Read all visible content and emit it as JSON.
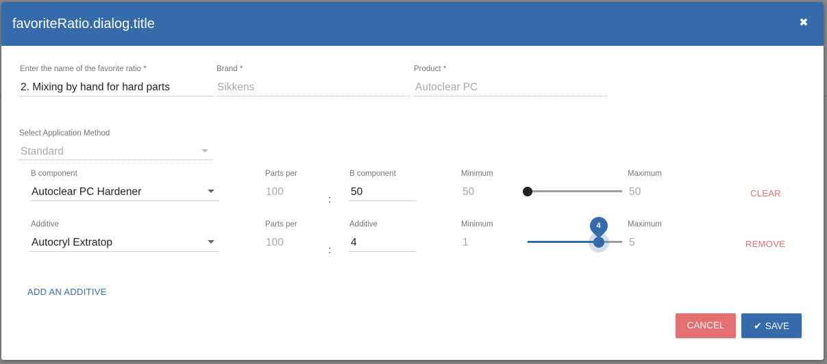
{
  "dialog": {
    "title": "favoriteRatio.dialog.title",
    "close_icon": "close-icon"
  },
  "form": {
    "name": {
      "label": "Enter the name of the favorite ratio *",
      "value": "2. Mixing by hand for hard parts"
    },
    "brand": {
      "label": "Brand *",
      "value": "Sikkens"
    },
    "product": {
      "label": "Product *",
      "value": "Autoclear PC"
    },
    "application_method": {
      "label": "Select Application Method",
      "value": "Standard"
    }
  },
  "rows": [
    {
      "component_label": "B component",
      "component_value": "Autoclear PC Hardener",
      "parts_label": "Parts per",
      "parts_value": "100",
      "separator": ":",
      "amount_label": "B component",
      "amount_value": "50",
      "min_label": "Minimum",
      "min_value": "50",
      "max_label": "Maximum",
      "max_value": "50",
      "slider_fraction": 0,
      "action": "CLEAR"
    },
    {
      "component_label": "Additive",
      "component_value": "Autocryl Extratop",
      "parts_label": "Parts per",
      "parts_value": "100",
      "separator": ":",
      "amount_label": "Additive",
      "amount_value": "4",
      "min_label": "Minimum",
      "min_value": "1",
      "max_label": "Maximum",
      "max_value": "5",
      "slider_value": "4",
      "slider_fraction": 0.75,
      "action": "REMOVE"
    }
  ],
  "add_additive": "ADD AN ADDITIVE",
  "buttons": {
    "cancel": "CANCEL",
    "save": "SAVE"
  },
  "colors": {
    "primary": "#366bab",
    "danger": "#e37070"
  }
}
